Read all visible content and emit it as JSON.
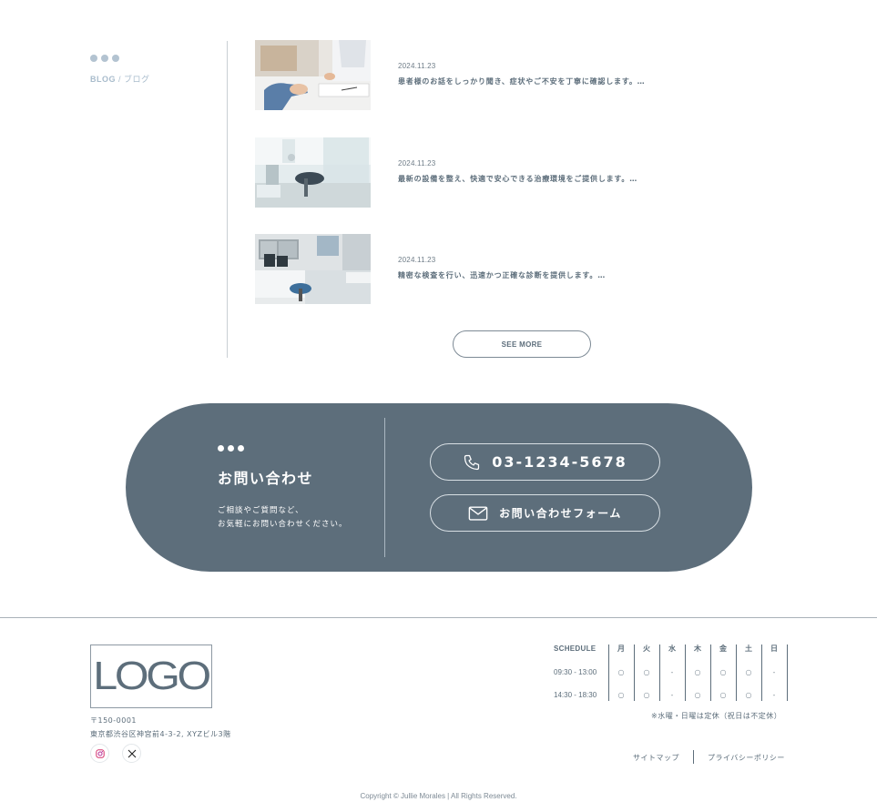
{
  "blog": {
    "label_en": "BLOG",
    "label_sep": " / ",
    "label_ja": "ブログ",
    "posts": [
      {
        "date": "2024.11.23",
        "excerpt": "患者様のお話をしっかり聞き、症状やご不安を丁寧に確認します。…",
        "image": "consultation"
      },
      {
        "date": "2024.11.23",
        "excerpt": "最新の設備を整え、快適で安心できる治療環境をご提供します。…",
        "image": "treatment-room"
      },
      {
        "date": "2024.11.23",
        "excerpt": "精密な検査を行い、迅速かつ正確な診断を提供します。…",
        "image": "exam-room"
      }
    ],
    "see_more": "SEE MORE"
  },
  "contact": {
    "title": "お問い合わせ",
    "desc_line1": "ご相談やご質問など、",
    "desc_line2": "お気軽にお問い合わせください。",
    "phone": "03-1234-5678",
    "phone_icon": "phone-icon",
    "form_label": "お問い合わせフォーム",
    "form_icon": "mail-icon"
  },
  "footer": {
    "logo": "LOGO",
    "postal": "〒150-0001",
    "address": "東京都渋谷区神宮前4-3-2, XYZビル3階",
    "social": [
      "instagram-icon",
      "x-icon"
    ],
    "schedule": {
      "label": "SCHEDULE",
      "days": [
        "月",
        "火",
        "水",
        "木",
        "金",
        "土",
        "日"
      ],
      "rows": [
        {
          "time": "09:30 - 13:00",
          "marks": [
            "○",
            "○",
            "-",
            "○",
            "○",
            "○",
            "-"
          ]
        },
        {
          "time": "14:30 - 18:30",
          "marks": [
            "○",
            "○",
            "-",
            "○",
            "○",
            "○",
            "-"
          ]
        }
      ],
      "note": "※水曜・日曜は定休（祝日は不定休）"
    },
    "links": [
      "サイトマップ",
      "プライバシーポリシー"
    ],
    "copyright": "Copyright © Jullie Morales | All Rights Reserved."
  },
  "colors": {
    "primary": "#5d6e7b",
    "accent_dots": "#b3c3d1",
    "background": "#ffffff"
  }
}
